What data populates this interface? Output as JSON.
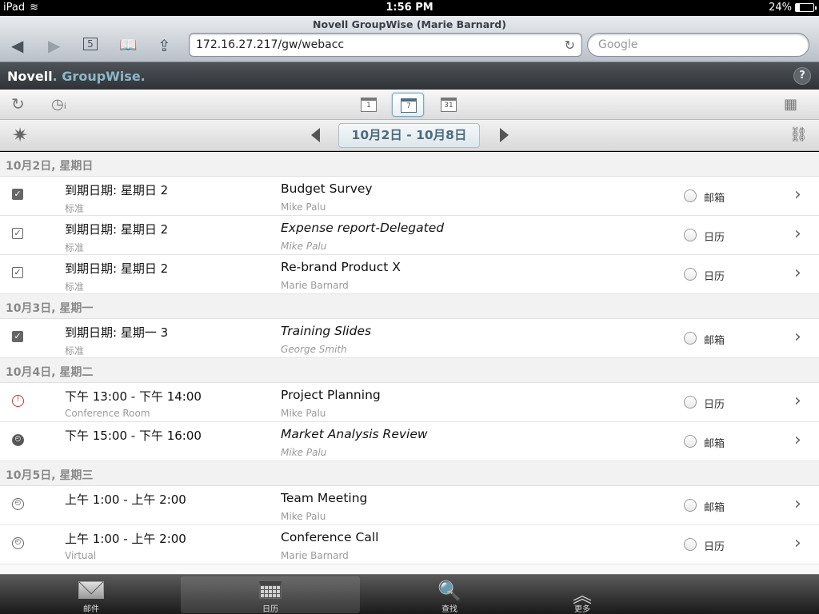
{
  "statusbar": {
    "device": "iPad",
    "time": "1:56 PM",
    "battery": "24%",
    "battery_level": 0.24
  },
  "browser": {
    "page_title": "Novell GroupWise (Marie Barnard)",
    "url": "172.16.27.217/gw/webacc",
    "search_placeholder": "Google",
    "tabs_count": "5"
  },
  "app": {
    "brand_novell": "Novell",
    "brand_groupwise": "GroupWise",
    "help": "?"
  },
  "toolbar": {
    "view_day": "1",
    "view_week": "7",
    "view_month": "31"
  },
  "datenav": {
    "range": "10月2日 - 10月8日"
  },
  "days": [
    {
      "header": "10月2日, 星期日",
      "items": [
        {
          "when": "到期日期:  星期日 2",
          "sub": "标准",
          "subject": "Budget Survey",
          "from": "Mike Palu",
          "place": "邮箱",
          "icon": "task-attachment-icon"
        },
        {
          "when": "到期日期:  星期日 2",
          "sub": "标准",
          "subject": "Expense report-Delegated",
          "from": "Mike Palu",
          "place": "日历",
          "icon": "task-icon"
        },
        {
          "when": "到期日期:  星期日 2",
          "sub": "标准",
          "subject": "Re-brand Product X",
          "from": "Marie Barnard",
          "place": "日历",
          "icon": "task-icon"
        }
      ]
    },
    {
      "header": "10月3日, 星期一",
      "items": [
        {
          "when": "到期日期:  星期一 3",
          "sub": "标准",
          "subject": "Training Slides",
          "from": "George Smith",
          "place": "邮箱",
          "icon": "task-filled-icon"
        }
      ]
    },
    {
      "header": "10月4日, 星期二",
      "items": [
        {
          "when": "下午 13:00 - 下午 14:00",
          "sub": "Conference Room",
          "subject": "Project Planning",
          "from": "Mike Palu",
          "place": "日历",
          "icon": "appointment-alarm-icon"
        },
        {
          "when": "下午 15:00 - 下午 16:00",
          "sub": "",
          "subject": "Market Analysis Review",
          "from": "Mike Palu",
          "place": "邮箱",
          "icon": "appointment-icon"
        }
      ]
    },
    {
      "header": "10月5日, 星期三",
      "items": [
        {
          "when": "上午 1:00 - 上午 2:00",
          "sub": "",
          "subject": "Team Meeting",
          "from": "Mike Palu",
          "place": "邮箱",
          "icon": "clock-icon"
        },
        {
          "when": "上午 1:00 - 上午 2:00",
          "sub": "Virtual",
          "subject": "Conference Call",
          "from": "Marie Barnard",
          "place": "日历",
          "icon": "clock-icon"
        }
      ]
    }
  ],
  "tabbar": {
    "mail": "邮件",
    "calendar": "日历",
    "find": "查找",
    "more": "更多"
  }
}
